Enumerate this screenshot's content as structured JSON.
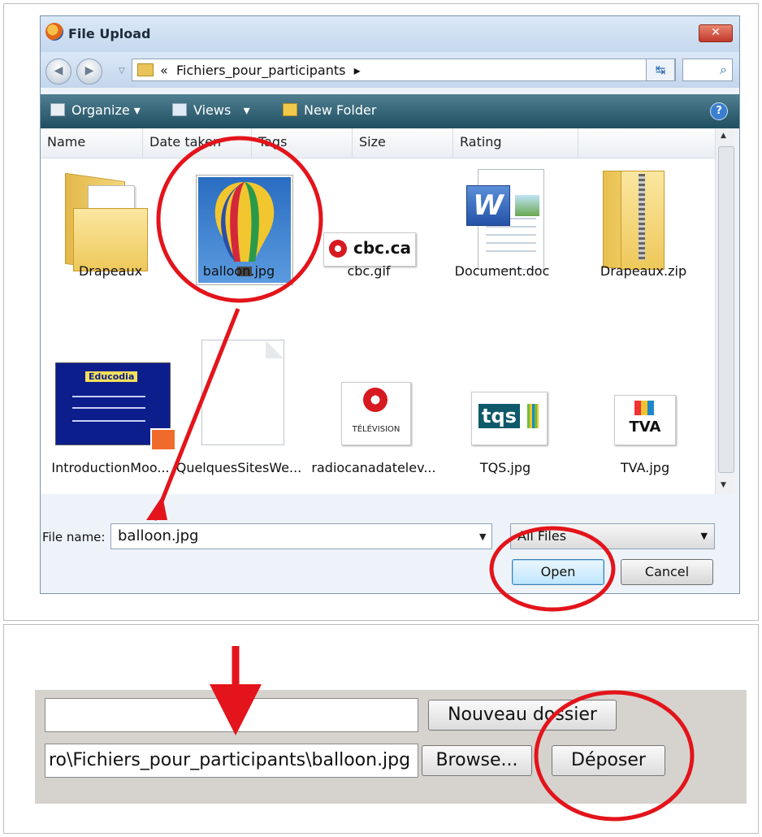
{
  "dialog": {
    "title": "File Upload",
    "close_icon": "close-icon",
    "nav": {
      "back_icon": "back-arrow-icon",
      "forward_icon": "forward-arrow-icon",
      "path_prefix": "«",
      "path": "Fichiers_pour_participants",
      "path_chevron": "▸"
    },
    "toolbar": {
      "organize": "Organize",
      "views": "Views",
      "new_folder": "New Folder",
      "dropdown_marker": "▾",
      "help": "?"
    },
    "columns": [
      "Name",
      "Date taken",
      "Tags",
      "Size",
      "Rating"
    ],
    "files": [
      {
        "label": "Drapeaux",
        "icon": "folder-icon"
      },
      {
        "label": "balloon.jpg",
        "icon": "balloon-image-icon"
      },
      {
        "label": "cbc.gif",
        "icon": "cbc-logo-icon",
        "logo_text": "cbc.ca"
      },
      {
        "label": "Document.doc",
        "icon": "word-document-icon"
      },
      {
        "label": "Drapeaux.zip",
        "icon": "zip-folder-icon"
      },
      {
        "label": "IntroductionMoo...",
        "icon": "presentation-icon",
        "logo_text": "Educodia"
      },
      {
        "label": "QuelquesSitesWe...",
        "icon": "blank-document-icon"
      },
      {
        "label": "radiocanadatelev...",
        "icon": "radio-canada-logo-icon",
        "logo_text": "TÉLÉVISION"
      },
      {
        "label": "TQS.jpg",
        "icon": "tqs-logo-icon",
        "logo_text": "tqs"
      },
      {
        "label": "TVA.jpg",
        "icon": "tva-logo-icon",
        "logo_text": "TVA"
      }
    ],
    "file_name_label": "File name:",
    "file_name_value": "balloon.jpg",
    "filter_value": "All Files",
    "open_label": "Open",
    "cancel_label": "Cancel"
  },
  "form": {
    "folder_input_value": "",
    "new_folder_button": "Nouveau dossier",
    "file_path_value": "ro\\Fichiers_pour_participants\\balloon.jpg",
    "browse_button": "Browse...",
    "submit_button": "Déposer"
  },
  "annotations": {
    "color": "#e3141b",
    "marks": [
      "circle",
      "arrow"
    ]
  }
}
